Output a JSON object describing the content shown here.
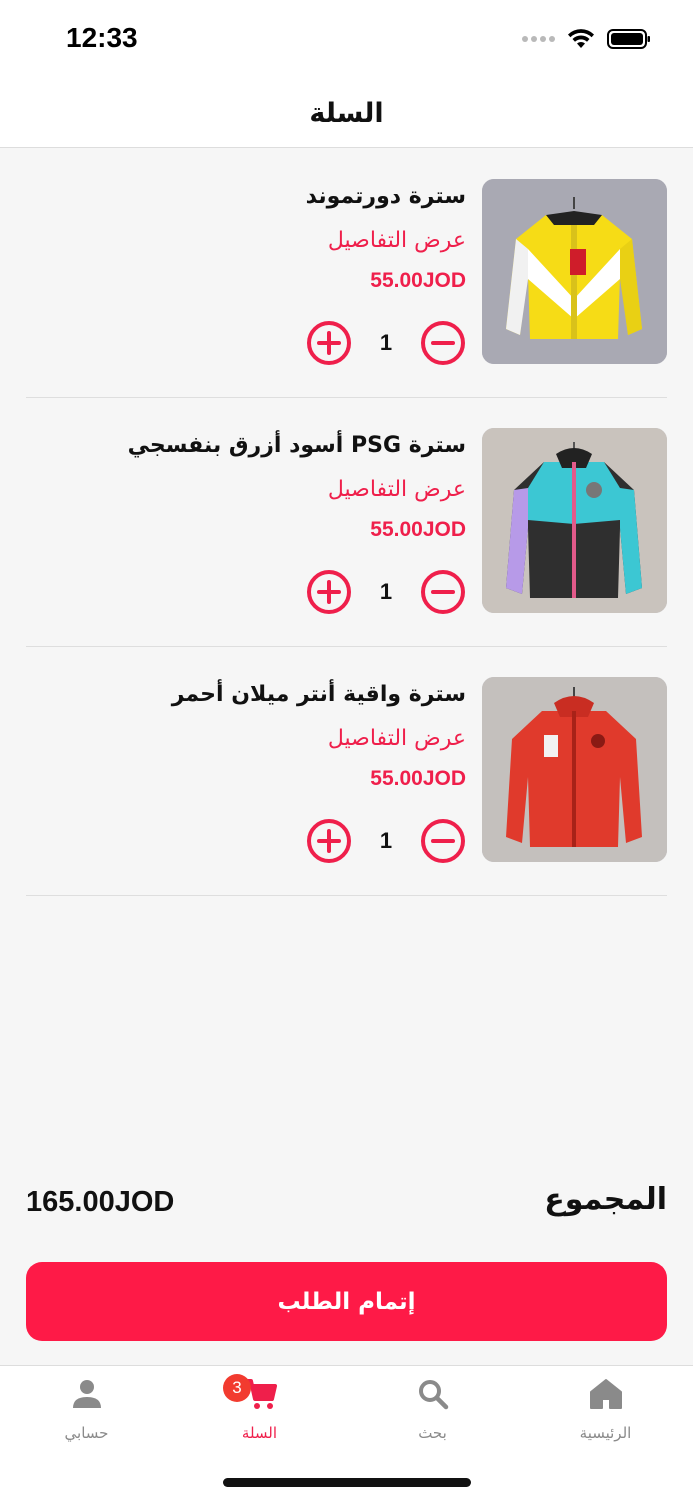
{
  "status_bar": {
    "time": "12:33"
  },
  "header": {
    "title": "السلة"
  },
  "colors": {
    "accent": "#fe1a47",
    "accent_text": "#ef1f4b",
    "badge": "#f23b2f"
  },
  "cart": {
    "items": [
      {
        "name": "سترة دورتموند",
        "details_link": "عرض التفاصيل",
        "price": "55.00JOD",
        "quantity": "1",
        "image_icon": "yellow-white-jacket"
      },
      {
        "name": "سترة PSG أسود أزرق بنفسجي",
        "details_link": "عرض التفاصيل",
        "price": "55.00JOD",
        "quantity": "1",
        "image_icon": "black-cyan-purple-jacket"
      },
      {
        "name": "سترة واقية  أنتر ميلان أحمر",
        "details_link": "عرض التفاصيل",
        "price": "55.00JOD",
        "quantity": "1",
        "image_icon": "red-jacket"
      }
    ]
  },
  "total": {
    "label": "المجموع",
    "amount": "165.00JOD"
  },
  "checkout": {
    "label": "إتمام الطلب"
  },
  "tab_bar": {
    "tabs": [
      {
        "label": "الرئيسية",
        "icon": "home-icon"
      },
      {
        "label": "بحث",
        "icon": "search-icon"
      },
      {
        "label": "السلة",
        "icon": "cart-icon",
        "badge": "3",
        "active": true
      },
      {
        "label": "حسابي",
        "icon": "person-icon"
      }
    ]
  }
}
